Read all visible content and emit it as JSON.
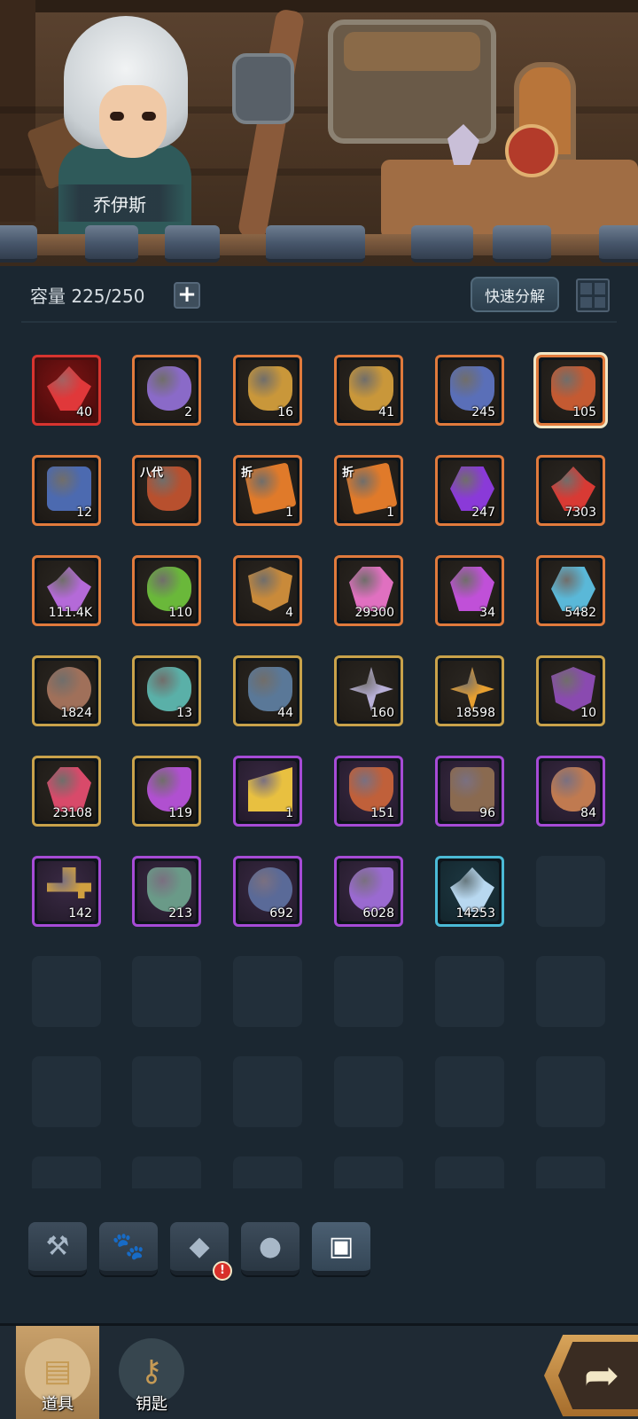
{
  "hero": {
    "name": "乔伊斯"
  },
  "toolbar": {
    "capacity_label": "容量 225/250",
    "plus_label": "+",
    "quick_decompose_label": "快速分解"
  },
  "items": [
    {
      "qty": "40",
      "rarity": "red",
      "icon": "red-crystal-icon",
      "color": "#e0383a"
    },
    {
      "qty": "2",
      "rarity": "orange",
      "icon": "purple-gift-bag-icon",
      "color": "#8a6ac8"
    },
    {
      "qty": "16",
      "rarity": "orange",
      "icon": "golden-vase-icon",
      "color": "#c9973a"
    },
    {
      "qty": "41",
      "rarity": "orange",
      "icon": "golden-vase-icon",
      "color": "#c9973a"
    },
    {
      "qty": "245",
      "rarity": "orange",
      "icon": "blue-vase-icon",
      "color": "#5a6fb8"
    },
    {
      "qty": "105",
      "rarity": "orange",
      "icon": "red-vase-icon",
      "color": "#c45a32",
      "selected": true
    },
    {
      "qty": "12",
      "rarity": "orange",
      "icon": "blue-chest-icon",
      "color": "#4c6ab0"
    },
    {
      "qty": "",
      "rarity": "orange",
      "icon": "eighth-gen-vase-icon",
      "color": "#b8502e",
      "tag": "八代"
    },
    {
      "qty": "1",
      "rarity": "orange",
      "icon": "discount-coupon-icon",
      "color": "#e07a2a",
      "tag": "折"
    },
    {
      "qty": "1",
      "rarity": "orange",
      "icon": "discount-coupon-icon",
      "color": "#e07a2a",
      "tag": "折"
    },
    {
      "qty": "247",
      "rarity": "orange",
      "icon": "purple-rune-stone-icon",
      "color": "#8a3ad8"
    },
    {
      "qty": "7303",
      "rarity": "orange",
      "icon": "red-crystal-icon",
      "color": "#d83a34"
    },
    {
      "qty": "111.4K",
      "rarity": "orange",
      "icon": "purple-crystal-cluster-icon",
      "color": "#b46ad8"
    },
    {
      "qty": "110",
      "rarity": "orange",
      "icon": "green-seed-pouch-icon",
      "color": "#6ab83a"
    },
    {
      "qty": "4",
      "rarity": "orange",
      "icon": "emblem-crest-icon",
      "color": "#c98a3a"
    },
    {
      "qty": "29300",
      "rarity": "orange",
      "icon": "pink-gem-icon",
      "color": "#e070c0"
    },
    {
      "qty": "34",
      "rarity": "orange",
      "icon": "violet-gem-icon",
      "color": "#c050d8"
    },
    {
      "qty": "5482",
      "rarity": "orange",
      "icon": "paw-hexagon-icon",
      "color": "#5ab8d8"
    },
    {
      "qty": "1824",
      "rarity": "gold",
      "icon": "horned-helmet-icon",
      "color": "#a0705a"
    },
    {
      "qty": "13",
      "rarity": "gold",
      "icon": "teal-gift-bag-icon",
      "color": "#5ab0a8"
    },
    {
      "qty": "44",
      "rarity": "gold",
      "icon": "steel-vase-icon",
      "color": "#5a7898"
    },
    {
      "qty": "160",
      "rarity": "gold",
      "icon": "silver-star-shard-icon",
      "color": "#b8b0d8"
    },
    {
      "qty": "18598",
      "rarity": "gold",
      "icon": "gold-star-shard-icon",
      "color": "#e8a030"
    },
    {
      "qty": "10",
      "rarity": "gold",
      "icon": "demon-mask-icon",
      "color": "#8a4ab0"
    },
    {
      "qty": "23108",
      "rarity": "gold",
      "icon": "rainbow-gem-cluster-icon",
      "color": "#d84a6a"
    },
    {
      "qty": "119",
      "rarity": "gold",
      "icon": "purple-flame-icon",
      "color": "#b050d0"
    },
    {
      "qty": "1",
      "rarity": "purple",
      "icon": "cheese-icon",
      "color": "#e8c040"
    },
    {
      "qty": "151",
      "rarity": "purple",
      "icon": "potion-bottle-icon",
      "color": "#c0603a"
    },
    {
      "qty": "96",
      "rarity": "purple",
      "icon": "crate-icon",
      "color": "#8a6a50"
    },
    {
      "qty": "84",
      "rarity": "purple",
      "icon": "orange-gift-bag-icon",
      "color": "#c07a50"
    },
    {
      "qty": "142",
      "rarity": "purple",
      "icon": "golden-key-icon",
      "color": "#d0a040"
    },
    {
      "qty": "213",
      "rarity": "purple",
      "icon": "stew-bowl-icon",
      "color": "#6a9a88"
    },
    {
      "qty": "692",
      "rarity": "purple",
      "icon": "iron-ring-icon",
      "color": "#5a6a98"
    },
    {
      "qty": "6028",
      "rarity": "purple",
      "icon": "purple-claw-icon",
      "color": "#9a6ad0"
    },
    {
      "qty": "14253",
      "rarity": "cyan",
      "icon": "ice-crystal-icon",
      "color": "#b8d8f0"
    }
  ],
  "category_tabs": [
    {
      "icon": "forge-hammer-icon",
      "glyph": "⚒"
    },
    {
      "icon": "paw-icon",
      "glyph": "🐾"
    },
    {
      "icon": "diamond-icon",
      "glyph": "◆",
      "alert": "!"
    },
    {
      "icon": "ore-icon",
      "glyph": "●"
    },
    {
      "icon": "chest-icon",
      "glyph": "▣",
      "active": true
    }
  ],
  "bottom_nav": {
    "items_label": "道具",
    "keys_label": "钥匙"
  },
  "colors": {
    "panel_bg": "#1b2731",
    "rarity_red": "#d8342f",
    "rarity_orange": "#e07a3c",
    "rarity_gold": "#c9a24a",
    "rarity_purple": "#a64bd6",
    "rarity_cyan": "#4bbad6"
  }
}
